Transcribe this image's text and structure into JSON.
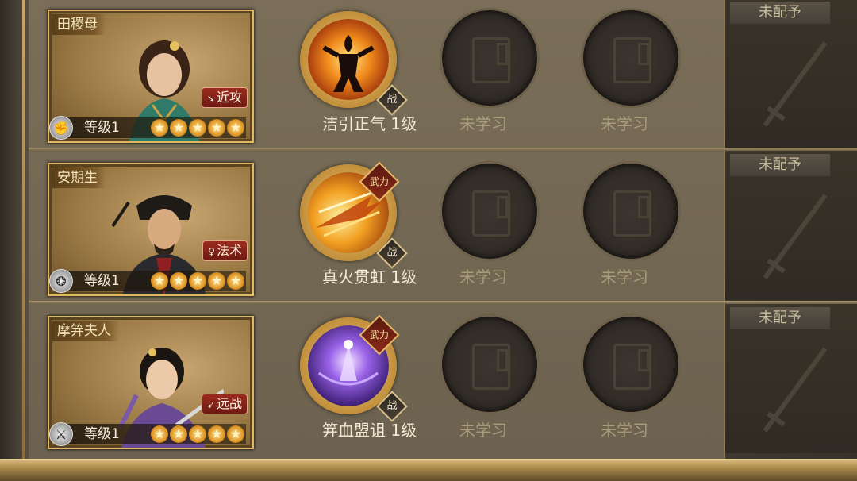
{
  "heroes": [
    {
      "name": "田稷母",
      "type_tag": "近攻",
      "level": "等级1",
      "stars": 5,
      "main_skill": {
        "label": "洁引正气 1级",
        "has_wuli": false,
        "zhan": "战"
      },
      "empty_skills": [
        "未学习",
        "未学习"
      ],
      "equip": "未配予"
    },
    {
      "name": "安期生",
      "type_tag": "法术",
      "level": "等级1",
      "stars": 5,
      "main_skill": {
        "label": "真火贯虹 1级",
        "has_wuli": true,
        "wuli": "武力",
        "zhan": "战"
      },
      "empty_skills": [
        "未学习",
        "未学习"
      ],
      "equip": "未配予"
    },
    {
      "name": "摩笄夫人",
      "type_tag": "远战",
      "level": "等级1",
      "stars": 5,
      "main_skill": {
        "label": "笄血盟诅 1级",
        "has_wuli": true,
        "wuli": "武力",
        "zhan": "战"
      },
      "empty_skills": [
        "未学习",
        "未学习"
      ],
      "equip": "未配予"
    }
  ],
  "colors": {
    "gold": "#e0b861",
    "panel": "#6c624f",
    "unlearned_text": "#aa9c7a"
  }
}
